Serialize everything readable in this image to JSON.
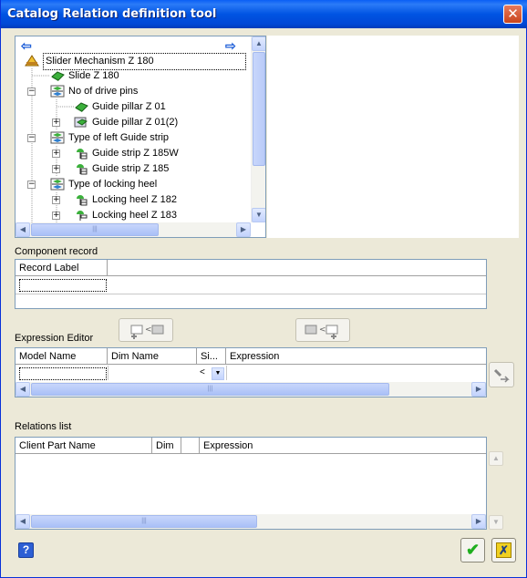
{
  "window": {
    "title": "Catalog Relation definition tool",
    "close_glyph": "✕"
  },
  "tree": {
    "back_glyph": "⇦",
    "forward_glyph": "⇨",
    "nodes": [
      {
        "label": "Slider Mechanism Z 180",
        "icon": "assembly-root-icon",
        "expander": ""
      },
      {
        "label": "Slide Z 180",
        "icon": "part-icon",
        "expander": ""
      },
      {
        "label": "No of drive pins",
        "icon": "alternative-group-icon",
        "expander": "−"
      },
      {
        "label": "Guide pillar Z 01",
        "icon": "part-icon",
        "expander": ""
      },
      {
        "label": "Guide pillar Z 01(2)",
        "icon": "assembly-icon",
        "expander": "+"
      },
      {
        "label": "Type of left Guide strip",
        "icon": "alternative-group-icon",
        "expander": "−"
      },
      {
        "label": "Guide strip Z 185W",
        "icon": "catalog-part-icon",
        "expander": "+"
      },
      {
        "label": "Guide strip Z 185",
        "icon": "catalog-part-icon",
        "expander": "+"
      },
      {
        "label": "Type of locking heel",
        "icon": "alternative-group-icon",
        "expander": "−"
      },
      {
        "label": "Locking heel Z 182",
        "icon": "catalog-part-icon",
        "expander": "+"
      },
      {
        "label": "Locking heel Z 183",
        "icon": "catalog-part-icon",
        "expander": "+"
      }
    ]
  },
  "component_record": {
    "label": "Component record",
    "columns": [
      "Record Label"
    ]
  },
  "expression_editor": {
    "label": "Expression Editor",
    "columns": [
      "Model Name",
      "Dim Name",
      "Si...",
      "Expression"
    ],
    "sign_value": "<"
  },
  "relations_list": {
    "label": "Relations list",
    "columns": [
      "Client Part Name",
      "Dim",
      "",
      "Expression"
    ]
  },
  "footer": {
    "help_glyph": "?",
    "ok_glyph": "✔",
    "cancel_glyph": "✗"
  },
  "colors": {
    "title_blue": "#0054e3",
    "dialog_bg": "#ece9d8",
    "ok_green": "#1fae1f",
    "cancel_gold": "#d8b000"
  }
}
